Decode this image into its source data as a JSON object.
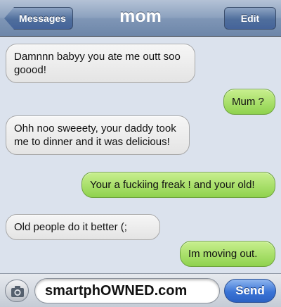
{
  "nav": {
    "back_label": "Messages",
    "title": "mom",
    "edit_label": "Edit"
  },
  "messages": [
    {
      "side": "in",
      "text": "Damnnn babyy you ate me outt soo goood!"
    },
    {
      "side": "out",
      "text": "Mum ?"
    },
    {
      "side": "in",
      "text": "Ohh noo sweeety, your daddy took me to dinner and it was delicious!"
    },
    {
      "side": "out",
      "text": "Your a fuckiing freak ! and your old!"
    },
    {
      "side": "in",
      "text": "Old people do it better (;"
    },
    {
      "side": "out",
      "text": "Im moving out."
    }
  ],
  "composer": {
    "camera_icon": "camera-icon",
    "field_text": "smartphOWNED.com",
    "send_label": "Send"
  },
  "colors": {
    "incoming_bubble": "#e9e9e9",
    "outgoing_bubble": "#9ed85a",
    "nav_bar": "#7f96b6",
    "send_button": "#3a74d6"
  }
}
